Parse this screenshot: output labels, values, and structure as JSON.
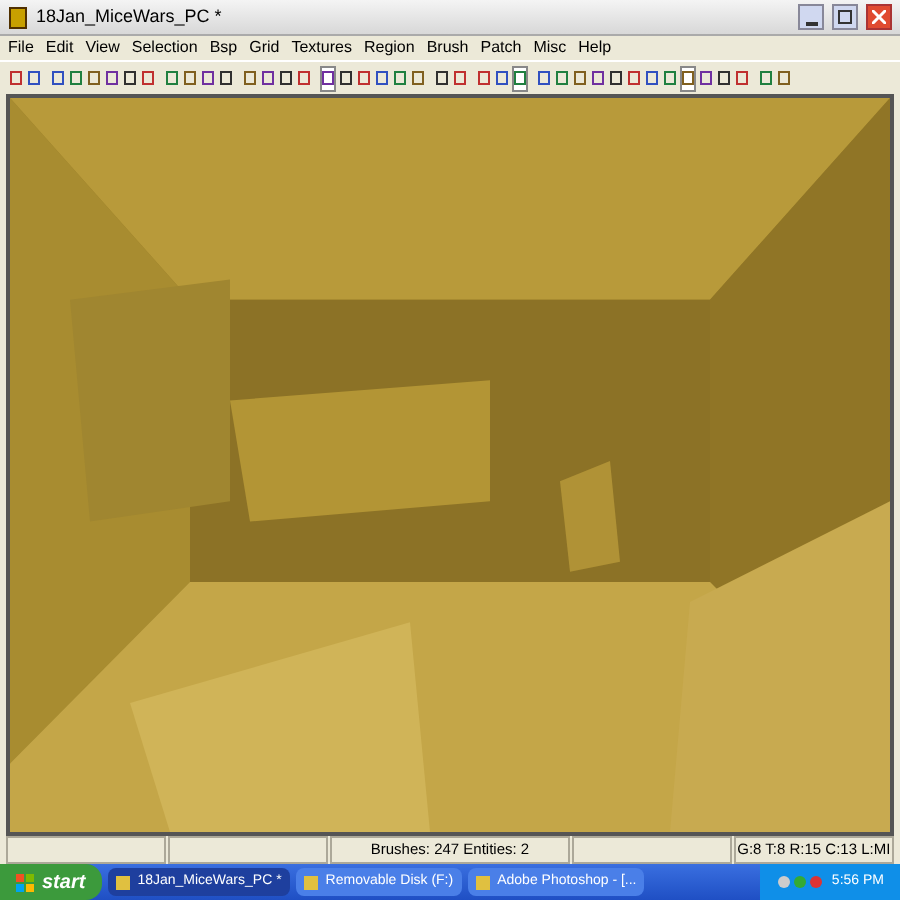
{
  "window": {
    "title": "18Jan_MiceWars_PC *"
  },
  "menu": [
    "File",
    "Edit",
    "View",
    "Selection",
    "Bsp",
    "Grid",
    "Textures",
    "Region",
    "Brush",
    "Patch",
    "Misc",
    "Help"
  ],
  "toolbar": [
    [
      {
        "selected": false
      },
      {
        "selected": false
      }
    ],
    [
      {
        "selected": false
      },
      {
        "selected": false
      },
      {
        "selected": false
      },
      {
        "selected": false
      },
      {
        "selected": false
      },
      {
        "selected": false
      }
    ],
    [
      {
        "selected": false
      },
      {
        "selected": false
      },
      {
        "selected": false
      },
      {
        "selected": false
      }
    ],
    [
      {
        "selected": false
      },
      {
        "selected": false
      },
      {
        "selected": false
      },
      {
        "selected": false
      }
    ],
    [
      {
        "selected": true
      },
      {
        "selected": false
      },
      {
        "selected": false
      },
      {
        "selected": false
      },
      {
        "selected": false
      },
      {
        "selected": false
      }
    ],
    [
      {
        "selected": false
      },
      {
        "selected": false
      }
    ],
    [
      {
        "selected": false
      },
      {
        "selected": false
      },
      {
        "selected": true
      }
    ],
    [
      {
        "selected": false
      },
      {
        "selected": false
      },
      {
        "selected": false
      },
      {
        "selected": false
      },
      {
        "selected": false
      },
      {
        "selected": false
      },
      {
        "selected": false
      },
      {
        "selected": false
      },
      {
        "selected": true
      },
      {
        "selected": false
      },
      {
        "selected": false
      },
      {
        "selected": false
      }
    ],
    [
      {
        "selected": false
      },
      {
        "selected": false
      }
    ]
  ],
  "status_bar": {
    "counts": "Brushes: 247 Entities: 2",
    "grid": "G:8 T:8 R:15 C:13 L:MI"
  },
  "taskbar": {
    "start": "start",
    "tasks": [
      {
        "label": "18Jan_MiceWars_PC *",
        "selected": true
      },
      {
        "label": "Removable Disk (F:)",
        "selected": false
      },
      {
        "label": "Adobe Photoshop - [...",
        "selected": false
      }
    ],
    "clock": "5:56 PM"
  }
}
